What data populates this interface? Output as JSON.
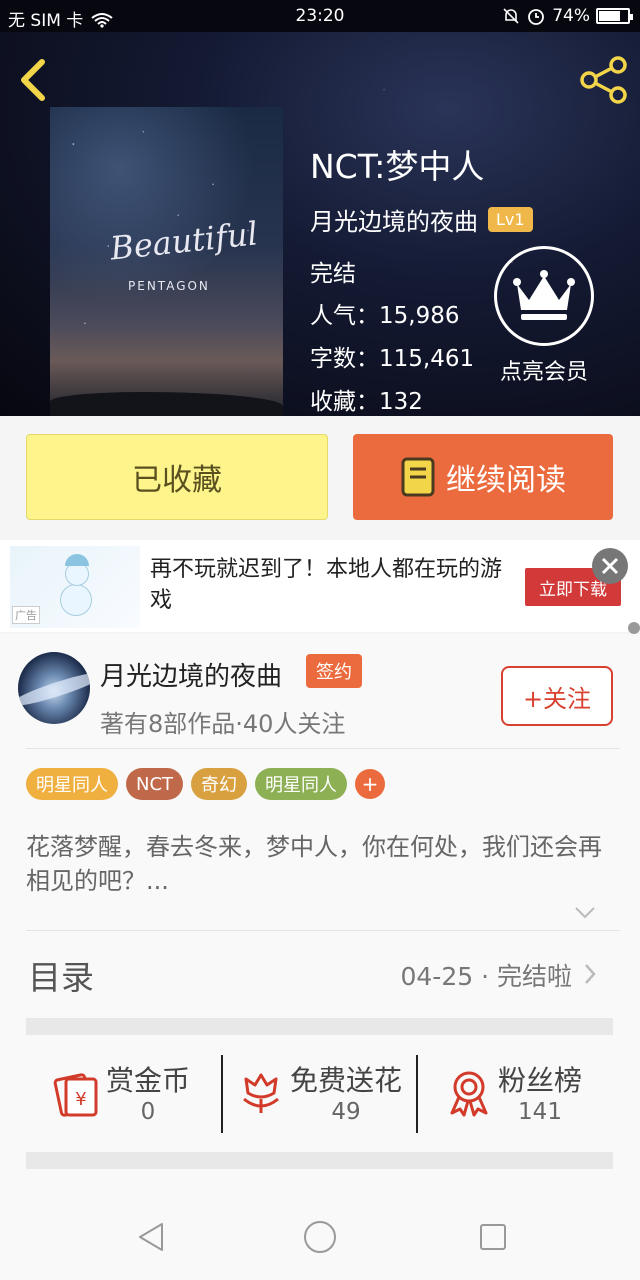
{
  "status_bar": {
    "carrier": "无 SIM 卡",
    "time": "23:20",
    "battery": "74%",
    "battery_level": 0.74
  },
  "book": {
    "title": "NCT:梦中人",
    "author": "月光边境的夜曲",
    "level": "Lv1",
    "status": "完结",
    "popularity": "人气：15,986",
    "word_count": "字数：115,461",
    "favorites": "收藏：132",
    "cover_script": "Beautiful",
    "cover_brand": "PENTAGON"
  },
  "vip": {
    "label": "点亮会员"
  },
  "actions": {
    "favorited_label": "已收藏",
    "continue_label": "继续阅读"
  },
  "ad": {
    "tag": "广告",
    "text": "再不玩就迟到了！本地人都在玩的游戏",
    "download_label": "立即下载"
  },
  "author": {
    "name": "月光边境的夜曲",
    "badge": "签约",
    "meta": "著有8部作品·40人关注",
    "follow_label": "+关注"
  },
  "tags": [
    {
      "label": "明星同人",
      "color": "#f0b040"
    },
    {
      "label": "NCT",
      "color": "#c0694a"
    },
    {
      "label": "奇幻",
      "color": "#d9a040"
    },
    {
      "label": "明星同人",
      "color": "#8db054"
    }
  ],
  "synopsis": "花落梦醒，春去冬来，梦中人，你在何处，我们还会再相见的吧？...",
  "toc": {
    "label": "目录",
    "status": "04-25 · 完结啦"
  },
  "rewards": [
    {
      "label": "赏金币",
      "value": "0",
      "icon": "red-envelope-icon"
    },
    {
      "label": "免费送花",
      "value": "49",
      "icon": "flower-icon"
    },
    {
      "label": "粉丝榜",
      "value": "141",
      "icon": "ribbon-medal-icon"
    }
  ],
  "colors": {
    "accent": "#ec6b3e",
    "favorited_bg": "#fdf48b",
    "follow_border": "#d94030"
  }
}
